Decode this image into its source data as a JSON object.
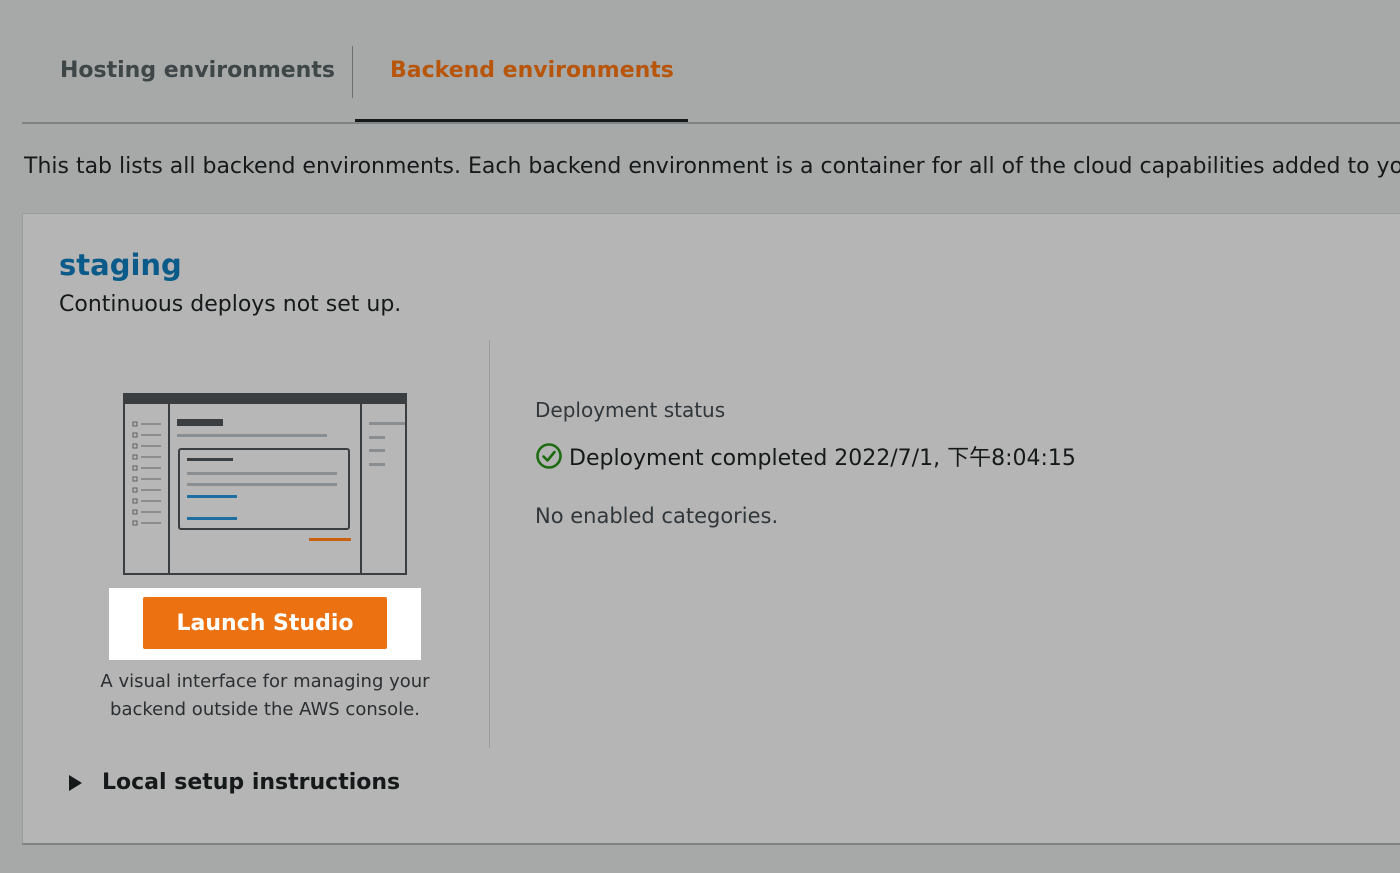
{
  "tabs": [
    {
      "label": "Hosting environments",
      "active": false
    },
    {
      "label": "Backend environments",
      "active": true
    }
  ],
  "intro_text": "This tab lists all backend environments. Each backend environment is a container for all of the cloud capabilities added to yo",
  "environment": {
    "name": "staging",
    "subtitle": "Continuous deploys not set up.",
    "launch_button_label": "Launch Studio",
    "launch_description": "A visual interface for managing your backend outside the AWS console.",
    "local_setup_label": "Local setup instructions",
    "deployment_status_label": "Deployment status",
    "deployment_status_text": "Deployment completed 2022/7/1, 下午8:04:15",
    "deployment_status_icon": "check-circle-icon",
    "categories_text": "No enabled categories."
  },
  "colors": {
    "accent_orange": "#ec7211",
    "active_tab": "#b7560b",
    "link_blue": "#0b5b8a",
    "success_green": "#1d8102"
  }
}
